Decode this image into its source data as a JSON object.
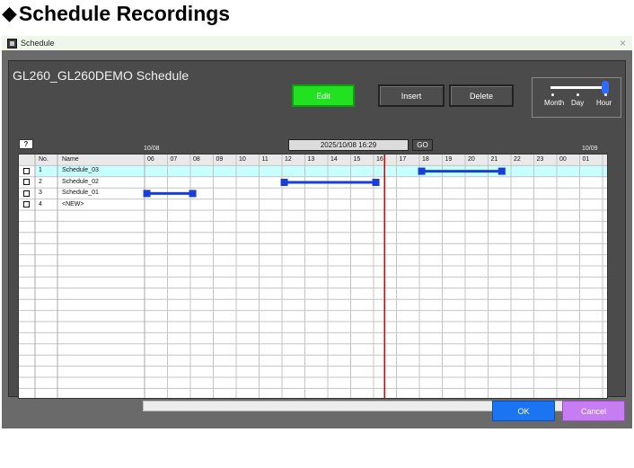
{
  "heading": {
    "diamond": "◆",
    "text": "Schedule Recordings"
  },
  "window": {
    "title": "Schedule",
    "close": "×"
  },
  "schedule": {
    "title": "GL260_GL260DEMO Schedule"
  },
  "toolbar": {
    "edit_label": "Edit",
    "insert_label": "Insert",
    "delete_label": "Delete"
  },
  "zoom": {
    "labels": [
      "Month",
      "Day",
      "Hour"
    ],
    "selected": "Hour"
  },
  "nav": {
    "help_label": "?",
    "start_date": "10/08",
    "end_date": "10/09",
    "current_datetime": "2025/10/08 16:29",
    "go_label": "GO"
  },
  "grid": {
    "headers": {
      "no": "No.",
      "name": "Name"
    },
    "hours": [
      "06",
      "07",
      "08",
      "09",
      "10",
      "11",
      "12",
      "13",
      "14",
      "15",
      "16",
      "17",
      "18",
      "19",
      "20",
      "21",
      "22",
      "23",
      "00",
      "01"
    ],
    "rows": [
      {
        "no": "1",
        "name": "Schedule_03",
        "start": 18.1,
        "end": 21.6,
        "selected": true
      },
      {
        "no": "2",
        "name": "Schedule_02",
        "start": 12.1,
        "end": 16.1,
        "selected": false
      },
      {
        "no": "3",
        "name": "Schedule_01",
        "start": 6.1,
        "end": 8.1,
        "selected": false
      },
      {
        "no": "4",
        "name": "<NEW>",
        "selected": false
      }
    ],
    "current_hour": 16.48,
    "colors": {
      "bar": "#1a3fd8",
      "now_line": "#e00000",
      "selected_row": "#c8ffff"
    }
  },
  "footer": {
    "ok_label": "OK",
    "cancel_label": "Cancel"
  }
}
